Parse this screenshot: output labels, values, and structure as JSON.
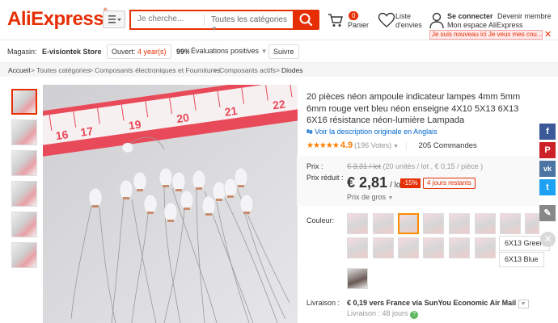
{
  "header": {
    "logo": "AliExpress",
    "logo_reg": "®",
    "search_placeholder": "Je cherche...",
    "category": "Toutes les catégories",
    "cart_count": "0",
    "cart_label": "Panier",
    "wish_line1": "Liste",
    "wish_line2": "d'envies",
    "signin": "Se connecter",
    "member": "Devenir membre",
    "my_space": "Mon espace AliExpress",
    "new_user": "Je suis nouveau ici Je veux mes cou..."
  },
  "store": {
    "label": "Magasin:",
    "name": "E-visiontek Store",
    "open_prefix": "Ouvert:",
    "open_value": "4 year(s)",
    "positive_pct": "99%",
    "positive_label": "Évaluations positives",
    "follow": "Suivre"
  },
  "breadcrumb": [
    "Accueil",
    "Toutes catégories",
    "Composants électroniques et Fournitures",
    "Composants actifs",
    "Diodes"
  ],
  "product": {
    "title": "20 pièces néon ampoule indicateur lampes 4mm 5mm 6mm rouge vert bleu néon enseigne 4X10 5X13 6X13 6X16 résistance néon-lumière Lampada",
    "translate": "Voir la description originale en Anglais",
    "rating": "4.9",
    "votes": "(196 Votes)",
    "orders": "205 Commandes",
    "price_label": "Prix :",
    "old_price": "€ 3,31 / lot",
    "old_price_detail": "(20 unités / lot , € 0,15 / pièce )",
    "discount_price_label": "Prix réduit :",
    "new_price": "€ 2,81",
    "new_price_unit": "/ lot",
    "discount": "-15%",
    "days_left": "4 jours restants",
    "wholesale": "Prix de gros",
    "color_label": "Couleur:",
    "color_options": [
      "6X13 Green",
      "6X13 Blue"
    ],
    "shipping_label": "Livraison :",
    "shipping": "€ 0,19 vers France via SunYou Economic Air Mail",
    "delivery": "Livraison : 48 jours"
  },
  "colors": {
    "brand": "#e62e04",
    "facebook": "#3b5998",
    "pinterest": "#cb2027",
    "vk": "#4c75a3",
    "twitter": "#1da1f2",
    "edit": "#888888"
  }
}
